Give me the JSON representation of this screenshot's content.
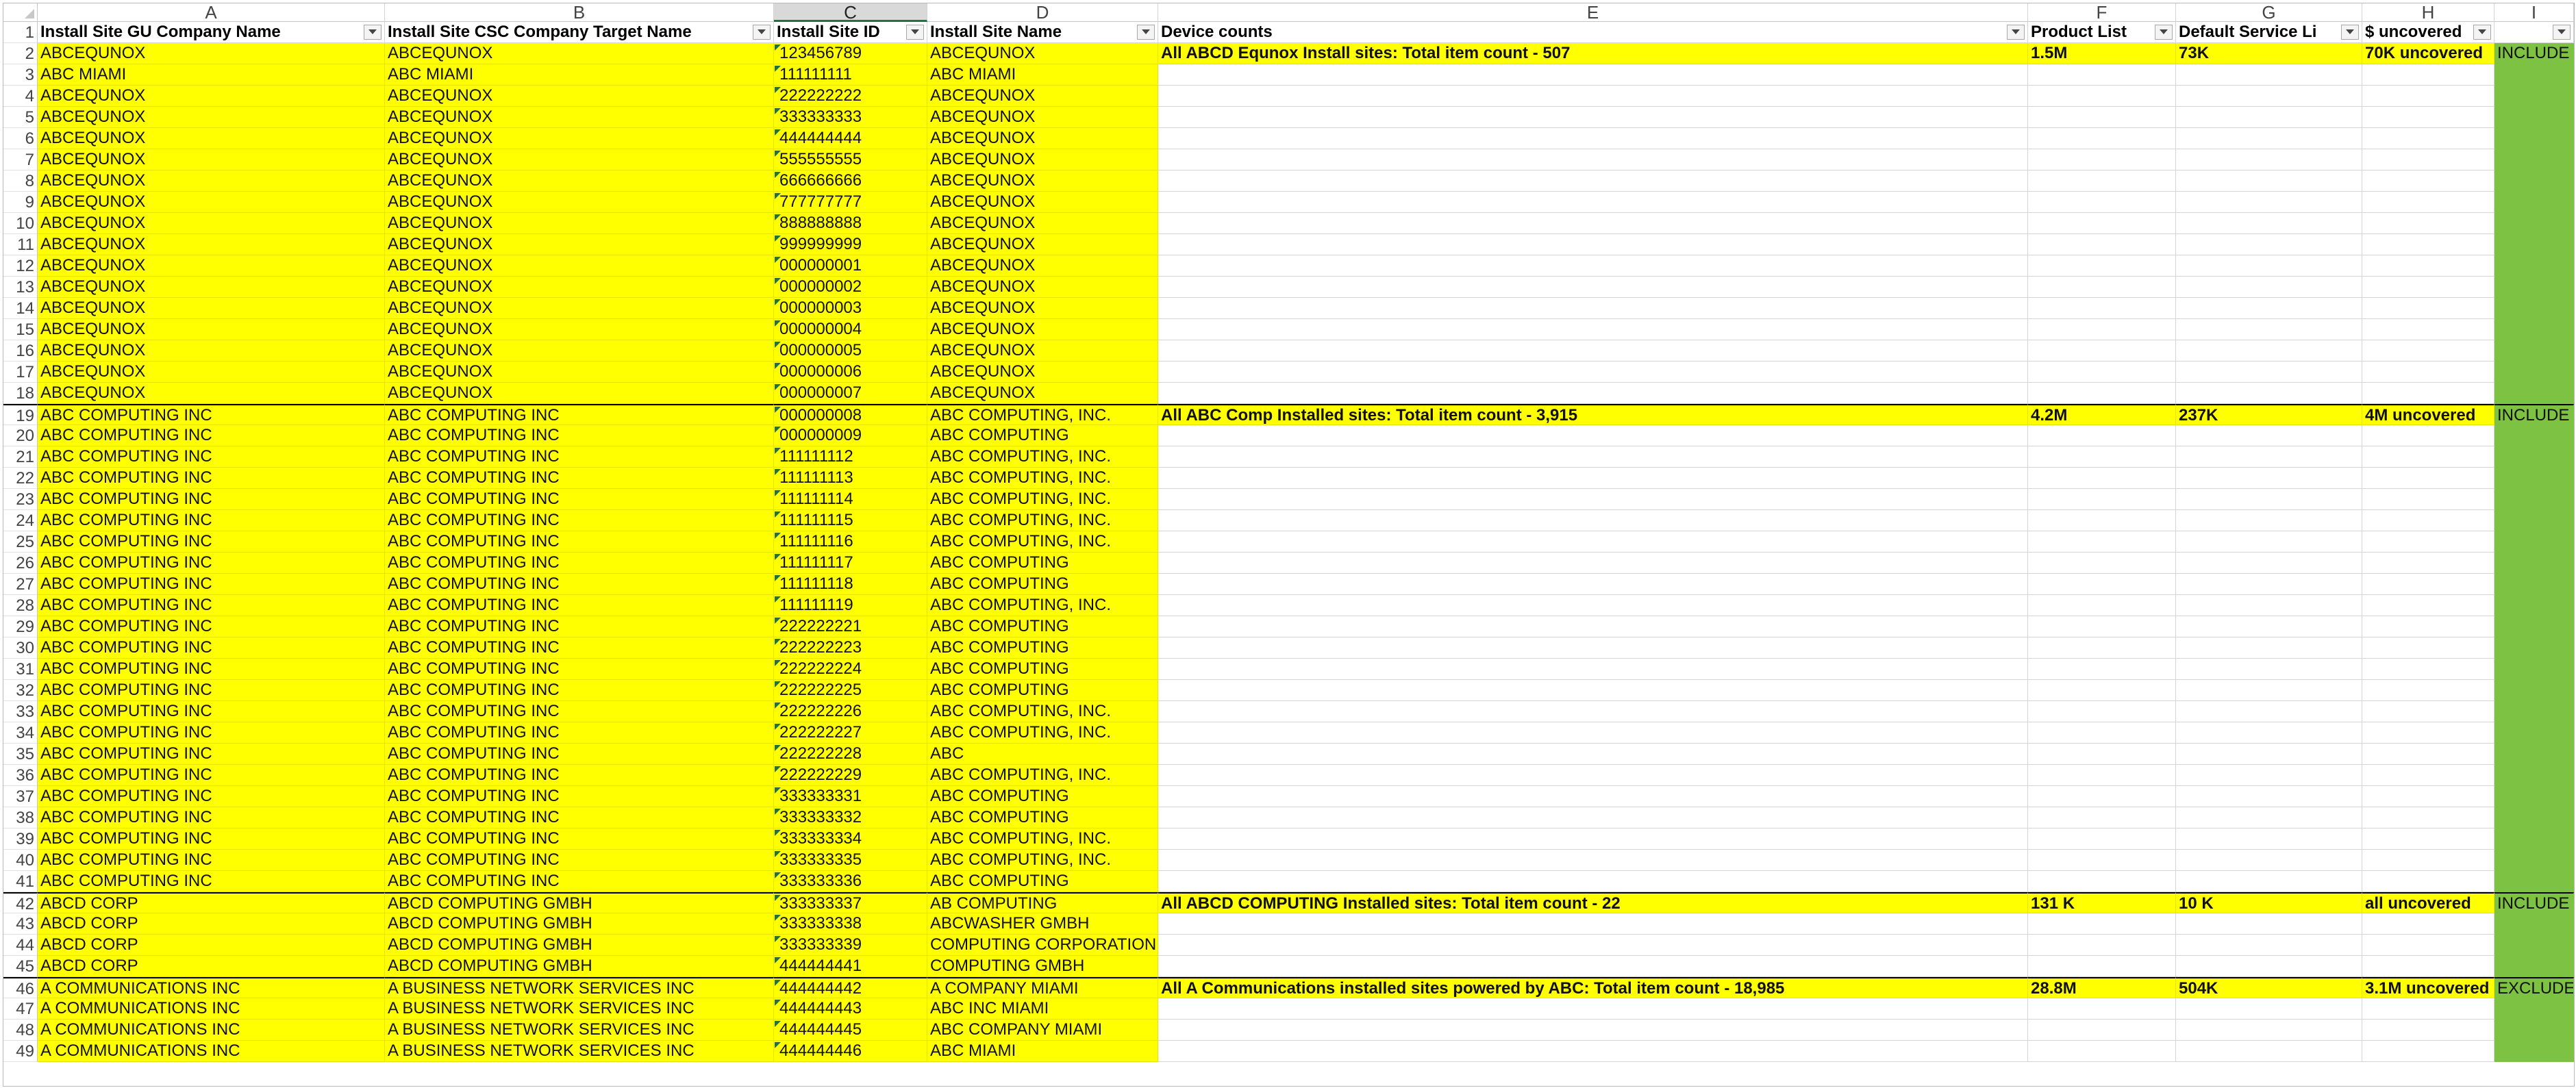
{
  "colors": {
    "yellow": "#FFFF00",
    "green": "#7DC242",
    "selected_header": "#D9D9D9",
    "error_triangle": "#1E7145"
  },
  "columns": [
    "A",
    "B",
    "C",
    "D",
    "E",
    "F",
    "G",
    "H",
    "I"
  ],
  "selected_column": "C",
  "header": {
    "row_number": "1",
    "cells": [
      "Install Site GU Company Name",
      "Install Site CSC Company Target Name",
      "Install Site ID",
      "Install Site Name",
      "Device counts",
      "Product List",
      "Default Service Li",
      "$ uncovered",
      ""
    ],
    "filter_icon": "dropdown-arrow-icon"
  },
  "rows": [
    {
      "n": "2",
      "a": "ABCEQUNOX",
      "b": "ABCEQUNOX",
      "c": "123456789",
      "d": "ABCEQUNOX",
      "e": "All ABCD Equnox Install sites: Total item count - 507",
      "f": "1.5M",
      "g": "73K",
      "h": "70K uncovered",
      "i": "INCLUDE"
    },
    {
      "n": "3",
      "a": "ABC MIAMI",
      "b": "ABC MIAMI",
      "c": "111111111",
      "d": "ABC MIAMI",
      "e": "",
      "f": "",
      "g": "",
      "h": "",
      "i": ""
    },
    {
      "n": "4",
      "a": "ABCEQUNOX",
      "b": "ABCEQUNOX",
      "c": "222222222",
      "d": "ABCEQUNOX",
      "e": "",
      "f": "",
      "g": "",
      "h": "",
      "i": ""
    },
    {
      "n": "5",
      "a": "ABCEQUNOX",
      "b": "ABCEQUNOX",
      "c": "333333333",
      "d": "ABCEQUNOX",
      "e": "",
      "f": "",
      "g": "",
      "h": "",
      "i": ""
    },
    {
      "n": "6",
      "a": "ABCEQUNOX",
      "b": "ABCEQUNOX",
      "c": "444444444",
      "d": "ABCEQUNOX",
      "e": "",
      "f": "",
      "g": "",
      "h": "",
      "i": ""
    },
    {
      "n": "7",
      "a": "ABCEQUNOX",
      "b": "ABCEQUNOX",
      "c": "555555555",
      "d": "ABCEQUNOX",
      "e": "",
      "f": "",
      "g": "",
      "h": "",
      "i": ""
    },
    {
      "n": "8",
      "a": "ABCEQUNOX",
      "b": "ABCEQUNOX",
      "c": "666666666",
      "d": "ABCEQUNOX",
      "e": "",
      "f": "",
      "g": "",
      "h": "",
      "i": ""
    },
    {
      "n": "9",
      "a": "ABCEQUNOX",
      "b": "ABCEQUNOX",
      "c": "777777777",
      "d": "ABCEQUNOX",
      "e": "",
      "f": "",
      "g": "",
      "h": "",
      "i": ""
    },
    {
      "n": "10",
      "a": "ABCEQUNOX",
      "b": "ABCEQUNOX",
      "c": "888888888",
      "d": "ABCEQUNOX",
      "e": "",
      "f": "",
      "g": "",
      "h": "",
      "i": ""
    },
    {
      "n": "11",
      "a": "ABCEQUNOX",
      "b": "ABCEQUNOX",
      "c": "999999999",
      "d": "ABCEQUNOX",
      "e": "",
      "f": "",
      "g": "",
      "h": "",
      "i": ""
    },
    {
      "n": "12",
      "a": "ABCEQUNOX",
      "b": "ABCEQUNOX",
      "c": "000000001",
      "d": "ABCEQUNOX",
      "e": "",
      "f": "",
      "g": "",
      "h": "",
      "i": ""
    },
    {
      "n": "13",
      "a": "ABCEQUNOX",
      "b": "ABCEQUNOX",
      "c": "000000002",
      "d": "ABCEQUNOX",
      "e": "",
      "f": "",
      "g": "",
      "h": "",
      "i": ""
    },
    {
      "n": "14",
      "a": "ABCEQUNOX",
      "b": "ABCEQUNOX",
      "c": "000000003",
      "d": "ABCEQUNOX",
      "e": "",
      "f": "",
      "g": "",
      "h": "",
      "i": ""
    },
    {
      "n": "15",
      "a": "ABCEQUNOX",
      "b": "ABCEQUNOX",
      "c": "000000004",
      "d": "ABCEQUNOX",
      "e": "",
      "f": "",
      "g": "",
      "h": "",
      "i": ""
    },
    {
      "n": "16",
      "a": "ABCEQUNOX",
      "b": "ABCEQUNOX",
      "c": "000000005",
      "d": "ABCEQUNOX",
      "e": "",
      "f": "",
      "g": "",
      "h": "",
      "i": ""
    },
    {
      "n": "17",
      "a": "ABCEQUNOX",
      "b": "ABCEQUNOX",
      "c": "000000006",
      "d": "ABCEQUNOX",
      "e": "",
      "f": "",
      "g": "",
      "h": "",
      "i": ""
    },
    {
      "n": "18",
      "a": "ABCEQUNOX",
      "b": "ABCEQUNOX",
      "c": "000000007",
      "d": "ABCEQUNOX",
      "e": "",
      "f": "",
      "g": "",
      "h": "",
      "i": ""
    },
    {
      "n": "19",
      "a": "ABC COMPUTING INC",
      "b": "ABC COMPUTING INC",
      "c": "000000008",
      "d": "ABC COMPUTING, INC.",
      "e": "All ABC Comp Installed sites: Total item count - 3,915",
      "f": "4.2M",
      "g": "237K",
      "h": "4M uncovered",
      "i": "INCLUDE",
      "top": true
    },
    {
      "n": "20",
      "a": "ABC COMPUTING INC",
      "b": "ABC COMPUTING INC",
      "c": "000000009",
      "d": "ABC COMPUTING",
      "e": "",
      "f": "",
      "g": "",
      "h": "",
      "i": ""
    },
    {
      "n": "21",
      "a": "ABC COMPUTING INC",
      "b": "ABC COMPUTING INC",
      "c": "111111112",
      "d": "ABC COMPUTING, INC.",
      "e": "",
      "f": "",
      "g": "",
      "h": "",
      "i": ""
    },
    {
      "n": "22",
      "a": "ABC COMPUTING INC",
      "b": "ABC COMPUTING INC",
      "c": "111111113",
      "d": "ABC COMPUTING, INC.",
      "e": "",
      "f": "",
      "g": "",
      "h": "",
      "i": ""
    },
    {
      "n": "23",
      "a": "ABC COMPUTING INC",
      "b": "ABC COMPUTING INC",
      "c": "111111114",
      "d": "ABC COMPUTING, INC.",
      "e": "",
      "f": "",
      "g": "",
      "h": "",
      "i": ""
    },
    {
      "n": "24",
      "a": "ABC COMPUTING INC",
      "b": "ABC COMPUTING INC",
      "c": "111111115",
      "d": "ABC COMPUTING, INC.",
      "e": "",
      "f": "",
      "g": "",
      "h": "",
      "i": ""
    },
    {
      "n": "25",
      "a": "ABC COMPUTING INC",
      "b": "ABC COMPUTING INC",
      "c": "111111116",
      "d": "ABC COMPUTING, INC.",
      "e": "",
      "f": "",
      "g": "",
      "h": "",
      "i": ""
    },
    {
      "n": "26",
      "a": "ABC COMPUTING INC",
      "b": "ABC COMPUTING INC",
      "c": "111111117",
      "d": "ABC COMPUTING",
      "e": "",
      "f": "",
      "g": "",
      "h": "",
      "i": ""
    },
    {
      "n": "27",
      "a": "ABC COMPUTING INC",
      "b": "ABC COMPUTING INC",
      "c": "111111118",
      "d": "ABC COMPUTING",
      "e": "",
      "f": "",
      "g": "",
      "h": "",
      "i": ""
    },
    {
      "n": "28",
      "a": "ABC COMPUTING INC",
      "b": "ABC COMPUTING INC",
      "c": "111111119",
      "d": "ABC COMPUTING, INC.",
      "e": "",
      "f": "",
      "g": "",
      "h": "",
      "i": ""
    },
    {
      "n": "29",
      "a": "ABC COMPUTING INC",
      "b": "ABC COMPUTING INC",
      "c": "222222221",
      "d": "ABC COMPUTING",
      "e": "",
      "f": "",
      "g": "",
      "h": "",
      "i": ""
    },
    {
      "n": "30",
      "a": "ABC COMPUTING INC",
      "b": "ABC COMPUTING INC",
      "c": "222222223",
      "d": "ABC COMPUTING",
      "e": "",
      "f": "",
      "g": "",
      "h": "",
      "i": ""
    },
    {
      "n": "31",
      "a": "ABC COMPUTING INC",
      "b": "ABC COMPUTING INC",
      "c": "222222224",
      "d": "ABC COMPUTING",
      "e": "",
      "f": "",
      "g": "",
      "h": "",
      "i": ""
    },
    {
      "n": "32",
      "a": "ABC COMPUTING INC",
      "b": "ABC COMPUTING INC",
      "c": "222222225",
      "d": "ABC COMPUTING",
      "e": "",
      "f": "",
      "g": "",
      "h": "",
      "i": ""
    },
    {
      "n": "33",
      "a": "ABC COMPUTING INC",
      "b": "ABC COMPUTING INC",
      "c": "222222226",
      "d": "ABC COMPUTING, INC.",
      "e": "",
      "f": "",
      "g": "",
      "h": "",
      "i": ""
    },
    {
      "n": "34",
      "a": "ABC COMPUTING INC",
      "b": "ABC COMPUTING INC",
      "c": "222222227",
      "d": "ABC COMPUTING, INC.",
      "e": "",
      "f": "",
      "g": "",
      "h": "",
      "i": ""
    },
    {
      "n": "35",
      "a": "ABC COMPUTING INC",
      "b": "ABC COMPUTING INC",
      "c": "222222228",
      "d": "ABC",
      "e": "",
      "f": "",
      "g": "",
      "h": "",
      "i": ""
    },
    {
      "n": "36",
      "a": "ABC COMPUTING INC",
      "b": "ABC COMPUTING INC",
      "c": "222222229",
      "d": "ABC COMPUTING, INC.",
      "e": "",
      "f": "",
      "g": "",
      "h": "",
      "i": ""
    },
    {
      "n": "37",
      "a": "ABC COMPUTING INC",
      "b": "ABC COMPUTING INC",
      "c": "333333331",
      "d": "ABC COMPUTING",
      "e": "",
      "f": "",
      "g": "",
      "h": "",
      "i": ""
    },
    {
      "n": "38",
      "a": "ABC COMPUTING INC",
      "b": "ABC COMPUTING INC",
      "c": "333333332",
      "d": "ABC COMPUTING",
      "e": "",
      "f": "",
      "g": "",
      "h": "",
      "i": ""
    },
    {
      "n": "39",
      "a": "ABC COMPUTING INC",
      "b": "ABC COMPUTING INC",
      "c": "333333334",
      "d": "ABC COMPUTING, INC.",
      "e": "",
      "f": "",
      "g": "",
      "h": "",
      "i": ""
    },
    {
      "n": "40",
      "a": "ABC COMPUTING INC",
      "b": "ABC COMPUTING INC",
      "c": "333333335",
      "d": "ABC COMPUTING, INC.",
      "e": "",
      "f": "",
      "g": "",
      "h": "",
      "i": ""
    },
    {
      "n": "41",
      "a": "ABC COMPUTING INC",
      "b": "ABC COMPUTING INC",
      "c": "333333336",
      "d": "ABC COMPUTING",
      "e": "",
      "f": "",
      "g": "",
      "h": "",
      "i": ""
    },
    {
      "n": "42",
      "a": "ABCD CORP",
      "b": "ABCD COMPUTING GMBH",
      "c": "333333337",
      "d": "AB COMPUTING",
      "e": "All ABCD COMPUTING Installed sites: Total item count - 22",
      "f": "131 K",
      "g": "10 K",
      "h": "all uncovered",
      "i": "INCLUDE",
      "top": true
    },
    {
      "n": "43",
      "a": "ABCD CORP",
      "b": "ABCD COMPUTING GMBH",
      "c": "333333338",
      "d": "ABCWASHER GMBH",
      "e": "",
      "f": "",
      "g": "",
      "h": "",
      "i": ""
    },
    {
      "n": "44",
      "a": "ABCD CORP",
      "b": "ABCD COMPUTING GMBH",
      "c": "333333339",
      "d": "COMPUTING CORPORATION",
      "e": "",
      "f": "",
      "g": "",
      "h": "",
      "i": ""
    },
    {
      "n": "45",
      "a": "ABCD CORP",
      "b": "ABCD COMPUTING GMBH",
      "c": "444444441",
      "d": "COMPUTING GMBH",
      "e": "",
      "f": "",
      "g": "",
      "h": "",
      "i": ""
    },
    {
      "n": "46",
      "a": "A COMMUNICATIONS INC",
      "b": "A BUSINESS NETWORK SERVICES INC",
      "c": "444444442",
      "d": "A COMPANY MIAMI",
      "e": "All A Communications installed sites powered by ABC: Total item count - 18,985",
      "f": "28.8M",
      "g": "504K",
      "h": "3.1M uncovered",
      "i": "EXCLUDE",
      "top": true
    },
    {
      "n": "47",
      "a": "A COMMUNICATIONS INC",
      "b": "A BUSINESS NETWORK SERVICES INC",
      "c": "444444443",
      "d": "ABC INC MIAMI",
      "e": "",
      "f": "",
      "g": "",
      "h": "",
      "i": ""
    },
    {
      "n": "48",
      "a": "A COMMUNICATIONS INC",
      "b": "A BUSINESS NETWORK SERVICES INC",
      "c": "444444445",
      "d": "ABC COMPANY MIAMI",
      "e": "",
      "f": "",
      "g": "",
      "h": "",
      "i": ""
    },
    {
      "n": "49",
      "a": "A COMMUNICATIONS INC",
      "b": "A BUSINESS NETWORK SERVICES INC",
      "c": "444444446",
      "d": "ABC MIAMI",
      "e": "",
      "f": "",
      "g": "",
      "h": "",
      "i": ""
    }
  ]
}
